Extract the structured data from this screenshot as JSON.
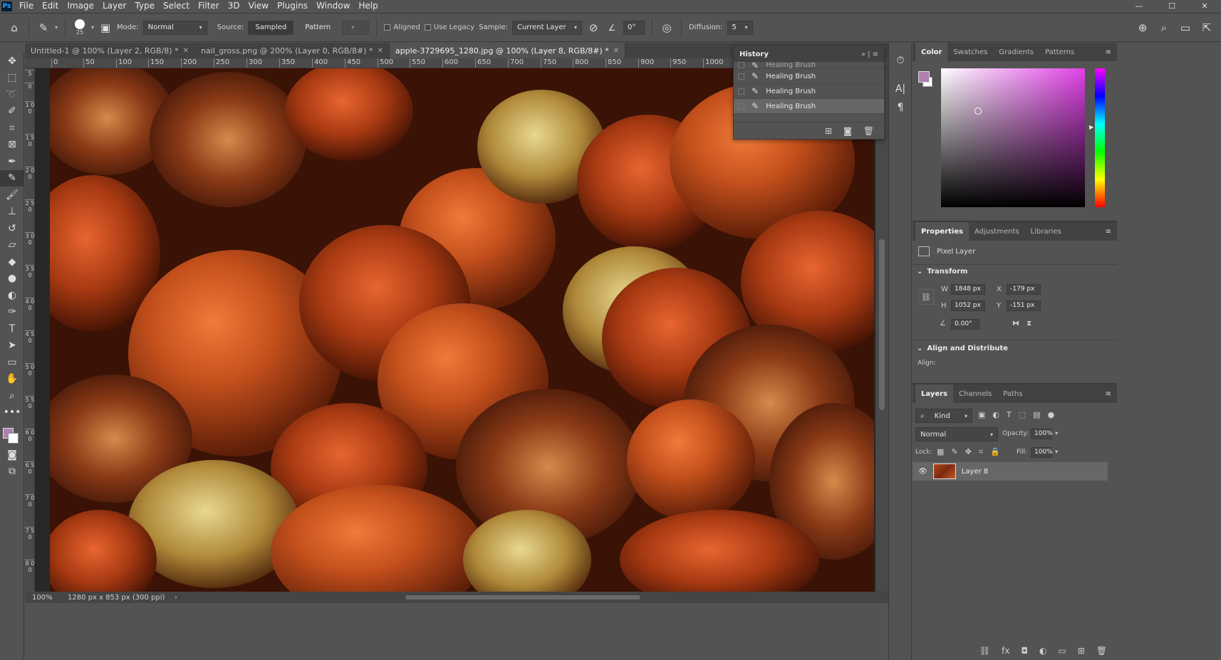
{
  "app": {
    "logo": "Ps"
  },
  "menu": [
    "File",
    "Edit",
    "Image",
    "Layer",
    "Type",
    "Select",
    "Filter",
    "3D",
    "View",
    "Plugins",
    "Window",
    "Help"
  ],
  "window_controls": {
    "minimize": "—",
    "maximize": "☐",
    "close": "✕"
  },
  "options": {
    "brush_size": "25",
    "mode_label": "Mode:",
    "mode_value": "Normal",
    "source_label": "Source:",
    "source_sampled": "Sampled",
    "source_pattern": "Pattern",
    "aligned_label": "Aligned",
    "use_legacy_label": "Use Legacy",
    "sample_label": "Sample:",
    "sample_value": "Current Layer",
    "angle_value": "0°",
    "diffusion_label": "Diffusion:",
    "diffusion_value": "5"
  },
  "tabs": [
    {
      "title": "Untitled-1 @ 100% (Layer 2, RGB/8) *",
      "active": false
    },
    {
      "title": "nail_gross.png @ 200% (Layer 0, RGB/8#) *",
      "active": false
    },
    {
      "title": "apple-3729695_1280.jpg @ 100% (Layer 8, RGB/8#) *",
      "active": true
    }
  ],
  "ruler_h": [
    "0",
    "50",
    "100",
    "150",
    "200",
    "250",
    "300",
    "350",
    "400",
    "450",
    "500",
    "550",
    "600",
    "650",
    "700",
    "750",
    "800",
    "850",
    "900",
    "950",
    "1000"
  ],
  "ruler_v": [
    "5",
    "0",
    "1 0 0",
    "1 5 0",
    "2 0 0",
    "2 5 0",
    "3 0 0",
    "3 5 0",
    "4 0 0",
    "4 5 0",
    "5 0 0",
    "5 5 0",
    "6 0 0",
    "6 5 0",
    "7 0 0",
    "7 5 0",
    "8 0 0"
  ],
  "status": {
    "zoom": "100%",
    "doc_info": "1280 px x 853 px (300 ppi)"
  },
  "history": {
    "title": "History",
    "items": [
      "Healing Brush",
      "Healing Brush",
      "Healing Brush",
      "Healing Brush"
    ],
    "selected_index": 3
  },
  "color_panel": {
    "tabs": [
      "Color",
      "Swatches",
      "Gradients",
      "Patterns"
    ],
    "foreground": "#b080b0",
    "background": "#ffffff"
  },
  "properties": {
    "tabs": [
      "Properties",
      "Adjustments",
      "Libraries"
    ],
    "layer_kind": "Pixel Layer",
    "transform_title": "Transform",
    "w_label": "W",
    "w_value": "1848 px",
    "h_label": "H",
    "h_value": "1052 px",
    "x_label": "X",
    "x_value": "-179 px",
    "y_label": "Y",
    "y_value": "-151 px",
    "angle_value": "0.00°",
    "align_title": "Align and Distribute",
    "align_label": "Align:"
  },
  "layers": {
    "tabs": [
      "Layers",
      "Channels",
      "Paths"
    ],
    "filter_kind": "Kind",
    "blend_mode": "Normal",
    "opacity_label": "Opacity:",
    "opacity_value": "100%",
    "lock_label": "Lock:",
    "fill_label": "Fill:",
    "fill_value": "100%",
    "items": [
      {
        "name": "Layer 8",
        "visible": true
      }
    ]
  }
}
